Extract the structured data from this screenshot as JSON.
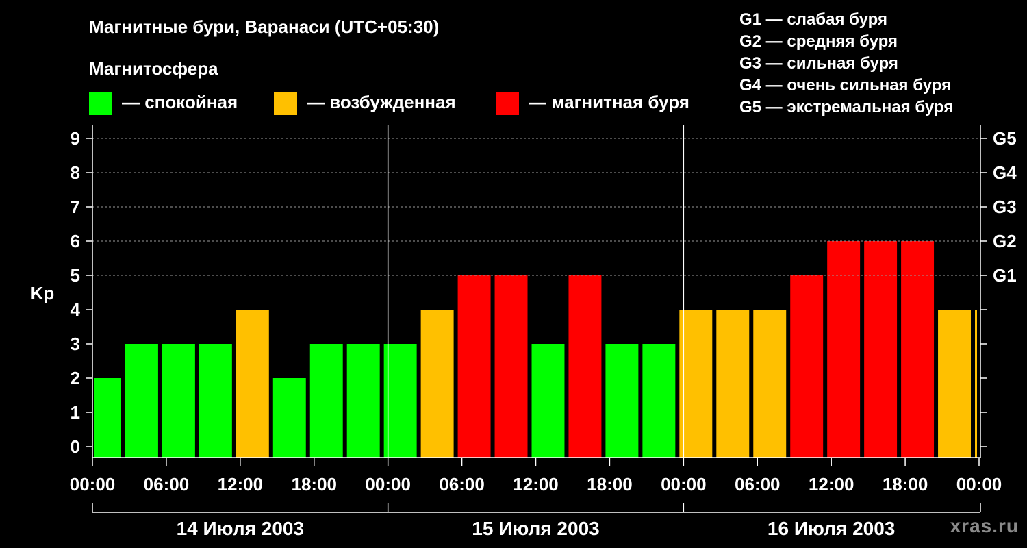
{
  "title": "Магнитные бури, Варанаси (UTC+05:30)",
  "legend": {
    "title": "Магнитосфера",
    "items": [
      {
        "label": "— спокойная",
        "color": "#00ff00"
      },
      {
        "label": "— возбужденная",
        "color": "#ffc000"
      },
      {
        "label": "— магнитная буря",
        "color": "#ff0000"
      }
    ]
  },
  "g_scale": [
    "G1 — слабая буря",
    "G2 — средняя буря",
    "G3 — сильная буря",
    "G4 — очень сильная буря",
    "G5 — экстремальная буря"
  ],
  "watermark": "xras.ru",
  "chart_data": {
    "type": "bar",
    "ylabel": "Kp",
    "ylim": [
      0,
      9
    ],
    "yticks": [
      0,
      1,
      2,
      3,
      4,
      5,
      6,
      7,
      8,
      9
    ],
    "right_ticks": [
      {
        "value": 5,
        "label": "G1"
      },
      {
        "value": 6,
        "label": "G2"
      },
      {
        "value": 7,
        "label": "G3"
      },
      {
        "value": 8,
        "label": "G4"
      },
      {
        "value": 9,
        "label": "G5"
      }
    ],
    "grid": true,
    "x_tick_labels": [
      "00:00",
      "06:00",
      "12:00",
      "18:00",
      "00:00",
      "06:00",
      "12:00",
      "18:00",
      "00:00",
      "06:00",
      "12:00",
      "18:00",
      "00:00"
    ],
    "days": [
      "14 Июля 2003",
      "15 Июля 2003",
      "16 Июля 2003"
    ],
    "bars": [
      {
        "start_hour": 0,
        "end_hour": 2.5,
        "kp": 2,
        "state": "quiet"
      },
      {
        "start_hour": 2.5,
        "end_hour": 5.5,
        "kp": 3,
        "state": "quiet"
      },
      {
        "start_hour": 5.5,
        "end_hour": 8.5,
        "kp": 3,
        "state": "quiet"
      },
      {
        "start_hour": 8.5,
        "end_hour": 11.5,
        "kp": 3,
        "state": "quiet"
      },
      {
        "start_hour": 11.5,
        "end_hour": 14.5,
        "kp": 4,
        "state": "active"
      },
      {
        "start_hour": 14.5,
        "end_hour": 17.5,
        "kp": 2,
        "state": "quiet"
      },
      {
        "start_hour": 17.5,
        "end_hour": 20.5,
        "kp": 3,
        "state": "quiet"
      },
      {
        "start_hour": 20.5,
        "end_hour": 23.5,
        "kp": 3,
        "state": "quiet"
      },
      {
        "start_hour": 23.5,
        "end_hour": 26.5,
        "kp": 3,
        "state": "quiet"
      },
      {
        "start_hour": 26.5,
        "end_hour": 29.5,
        "kp": 4,
        "state": "active"
      },
      {
        "start_hour": 29.5,
        "end_hour": 32.5,
        "kp": 5,
        "state": "storm"
      },
      {
        "start_hour": 32.5,
        "end_hour": 35.5,
        "kp": 5,
        "state": "storm"
      },
      {
        "start_hour": 35.5,
        "end_hour": 38.5,
        "kp": 3,
        "state": "quiet"
      },
      {
        "start_hour": 38.5,
        "end_hour": 41.5,
        "kp": 5,
        "state": "storm"
      },
      {
        "start_hour": 41.5,
        "end_hour": 44.5,
        "kp": 3,
        "state": "quiet"
      },
      {
        "start_hour": 44.5,
        "end_hour": 47.5,
        "kp": 3,
        "state": "quiet"
      },
      {
        "start_hour": 47.5,
        "end_hour": 50.5,
        "kp": 4,
        "state": "active"
      },
      {
        "start_hour": 50.5,
        "end_hour": 53.5,
        "kp": 4,
        "state": "active"
      },
      {
        "start_hour": 53.5,
        "end_hour": 56.5,
        "kp": 4,
        "state": "active"
      },
      {
        "start_hour": 56.5,
        "end_hour": 59.5,
        "kp": 5,
        "state": "storm"
      },
      {
        "start_hour": 59.5,
        "end_hour": 62.5,
        "kp": 6,
        "state": "storm"
      },
      {
        "start_hour": 62.5,
        "end_hour": 65.5,
        "kp": 6,
        "state": "storm"
      },
      {
        "start_hour": 65.5,
        "end_hour": 68.5,
        "kp": 6,
        "state": "storm"
      },
      {
        "start_hour": 68.5,
        "end_hour": 71.5,
        "kp": 4,
        "state": "active"
      },
      {
        "start_hour": 71.5,
        "end_hour": 72,
        "kp": 4,
        "state": "active"
      }
    ],
    "state_colors": {
      "quiet": "#00ff00",
      "active": "#ffc000",
      "storm": "#ff0000"
    }
  }
}
